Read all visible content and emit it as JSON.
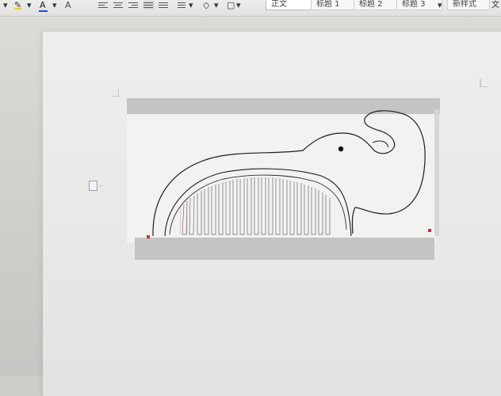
{
  "toolbar": {
    "font_size_marker": "A",
    "font_color_label": "A",
    "char_shading_label": "A",
    "style_normal": "正文",
    "style_heading1": "标题 1",
    "style_heading2": "标题 2",
    "style_heading3": "标题 3",
    "new_style": "新样式",
    "more_indicator": "文"
  },
  "colors": {
    "font_color_underline": "#1e50d0",
    "highlight_color": "#e8d23a",
    "handle_color": "#d03030"
  },
  "icons": {
    "highlight": "pen-icon",
    "font_color": "letter-a-icon",
    "align": "align-lines-icon",
    "border": "border-icon",
    "paragraph": "paragraph-mark-icon"
  },
  "document": {
    "drawing": "elephant-comb-sketch",
    "paragraph_dash": "-"
  }
}
